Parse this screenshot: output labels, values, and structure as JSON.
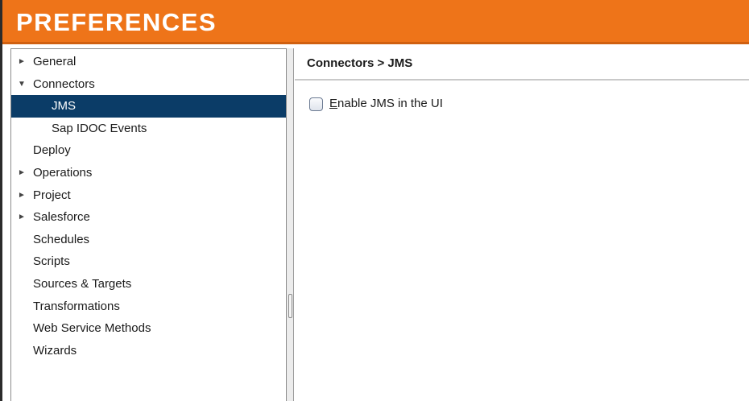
{
  "window": {
    "title": "PREFERENCES"
  },
  "nav": {
    "items": [
      {
        "label": "General",
        "arrow": "►",
        "level": 0,
        "selected": false
      },
      {
        "label": "Connectors",
        "arrow": "▼",
        "level": 0,
        "selected": false
      },
      {
        "label": "JMS",
        "arrow": "",
        "level": 1,
        "selected": true
      },
      {
        "label": "Sap IDOC Events",
        "arrow": "",
        "level": 1,
        "selected": false
      },
      {
        "label": "Deploy",
        "arrow": "",
        "level": 0,
        "selected": false
      },
      {
        "label": "Operations",
        "arrow": "►",
        "level": 0,
        "selected": false
      },
      {
        "label": "Project",
        "arrow": "►",
        "level": 0,
        "selected": false
      },
      {
        "label": "Salesforce",
        "arrow": "►",
        "level": 0,
        "selected": false
      },
      {
        "label": "Schedules",
        "arrow": "",
        "level": 0,
        "selected": false
      },
      {
        "label": "Scripts",
        "arrow": "",
        "level": 0,
        "selected": false
      },
      {
        "label": "Sources & Targets",
        "arrow": "",
        "level": 0,
        "selected": false
      },
      {
        "label": "Transformations",
        "arrow": "",
        "level": 0,
        "selected": false
      },
      {
        "label": "Web Service Methods",
        "arrow": "",
        "level": 0,
        "selected": false
      },
      {
        "label": "Wizards",
        "arrow": "",
        "level": 0,
        "selected": false
      }
    ]
  },
  "content": {
    "breadcrumb": "Connectors > JMS",
    "option": {
      "mnemonic": "E",
      "rest": "nable JMS in the UI",
      "checked": false
    }
  },
  "colors": {
    "title_bar": "#ee7419",
    "selection": "#0b3c67"
  }
}
